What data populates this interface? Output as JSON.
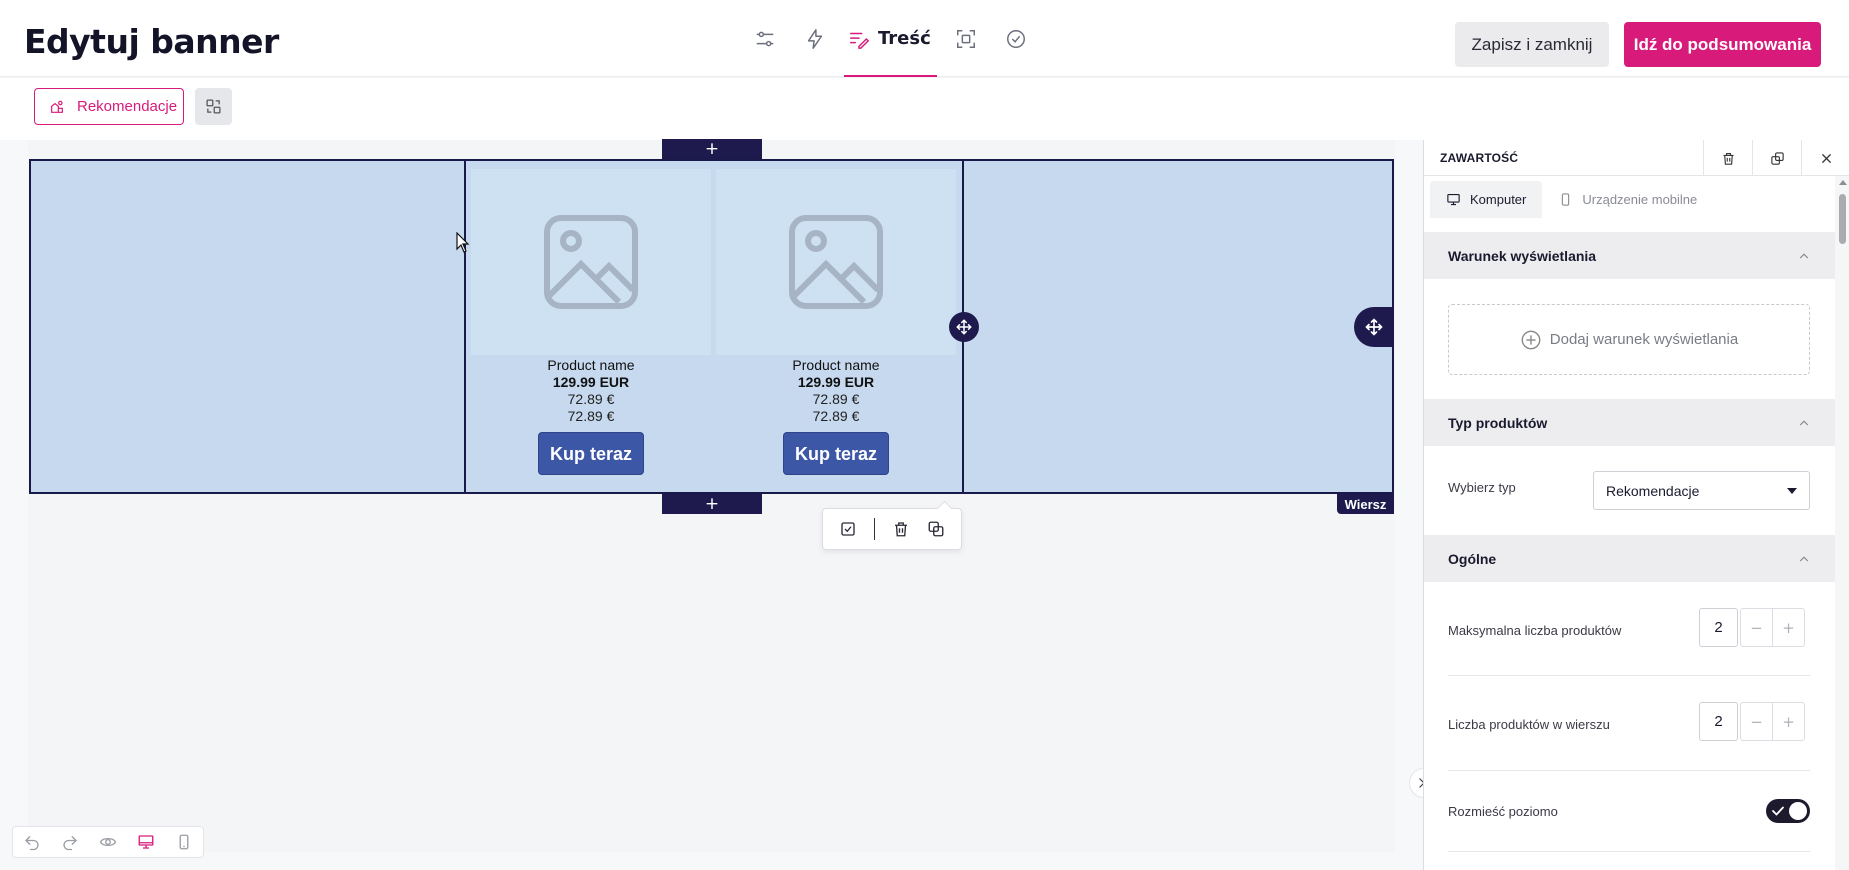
{
  "header": {
    "title": "Edytuj banner",
    "tabs": [
      {
        "icon": "sliders-icon"
      },
      {
        "icon": "bolt-icon"
      },
      {
        "icon": "content-edit-icon",
        "label": "Treść",
        "active": true
      },
      {
        "icon": "frame-icon"
      },
      {
        "icon": "check-circle-icon"
      }
    ],
    "save_label": "Zapisz i zamknij",
    "summary_label": "Idź do podsumowania",
    "accent_color": "#d81b7b"
  },
  "toolbar": {
    "recommendations_label": "Rekomendacje"
  },
  "canvas": {
    "products": [
      {
        "name": "Product name",
        "price": "129.99 EUR",
        "old_price_1": "72.89 €",
        "old_price_2": "72.89 €",
        "cta": "Kup teraz"
      },
      {
        "name": "Product name",
        "price": "129.99 EUR",
        "old_price_1": "72.89 €",
        "old_price_2": "72.89 €",
        "cta": "Kup teraz"
      }
    ],
    "add_symbol": "+",
    "row_label": "Wiersz"
  },
  "panel": {
    "title": "ZAWARTOŚĆ",
    "device_tabs": [
      "Komputer",
      "Urządzenie mobilne"
    ],
    "sections": {
      "display_condition": {
        "title": "Warunek wyświetlania",
        "add_label": "Dodaj warunek wyświetlania"
      },
      "product_type": {
        "title": "Typ produktów",
        "select_label": "Wybierz typ",
        "selected": "Rekomendacje"
      },
      "general": {
        "title": "Ogólne",
        "max_products_label": "Maksymalna liczba produktów",
        "max_products_value": "2",
        "per_row_label": "Liczba produktów w wierszu",
        "per_row_value": "2",
        "horizontal_label": "Rozmieść poziomo",
        "horizontal_enabled": true
      }
    }
  }
}
